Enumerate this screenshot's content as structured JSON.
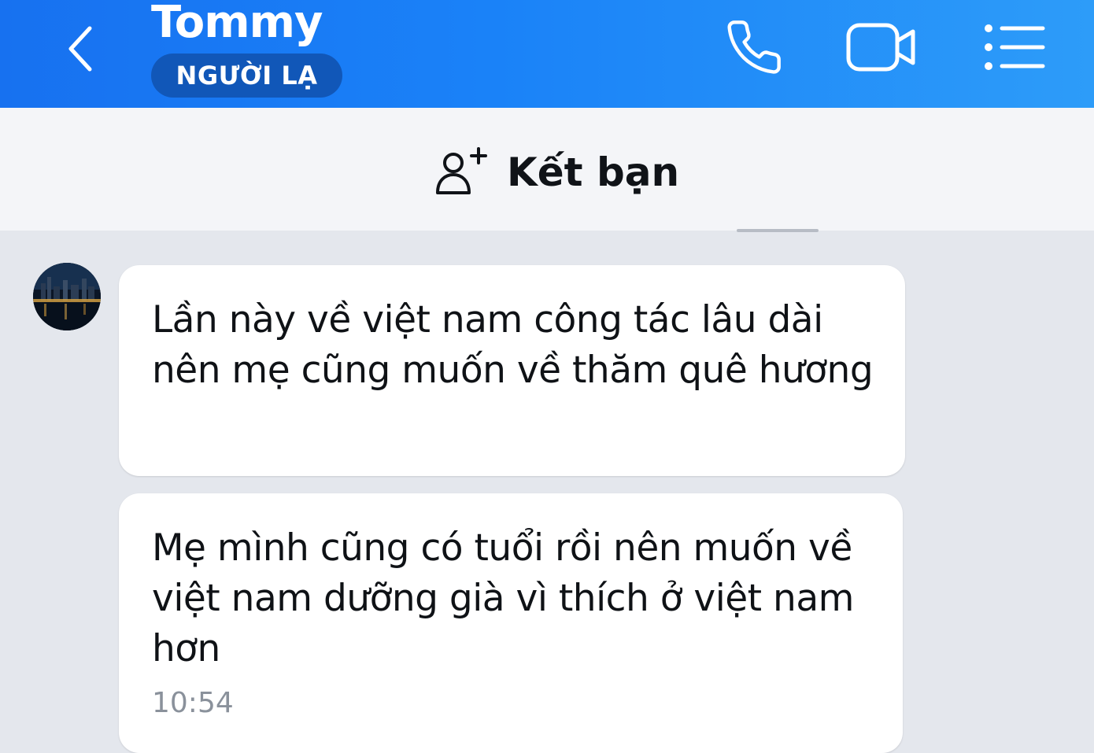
{
  "header": {
    "contact_name": "Tommy",
    "badge": "NGƯỜI LẠ",
    "icons": [
      "back-icon",
      "phone-icon",
      "video-call-icon",
      "menu-list-icon"
    ]
  },
  "add_friend": {
    "label": "Kết bạn",
    "icon": "add-user-icon"
  },
  "messages": [
    {
      "text": "Lần này về việt nam công tác lâu dài nên mẹ cũng muốn về thăm quê hương"
    },
    {
      "text": "Mẹ mình cũng có tuổi rồi nên muốn về việt nam dưỡng già vì thích ở việt nam hơn",
      "time": "10:54"
    }
  ],
  "colors": {
    "header_start": "#1771f0",
    "header_end": "#2d9cf9",
    "badge_bg": "#1157b8",
    "chat_bg": "#e4e7ed",
    "bubble_bg": "#ffffff"
  }
}
